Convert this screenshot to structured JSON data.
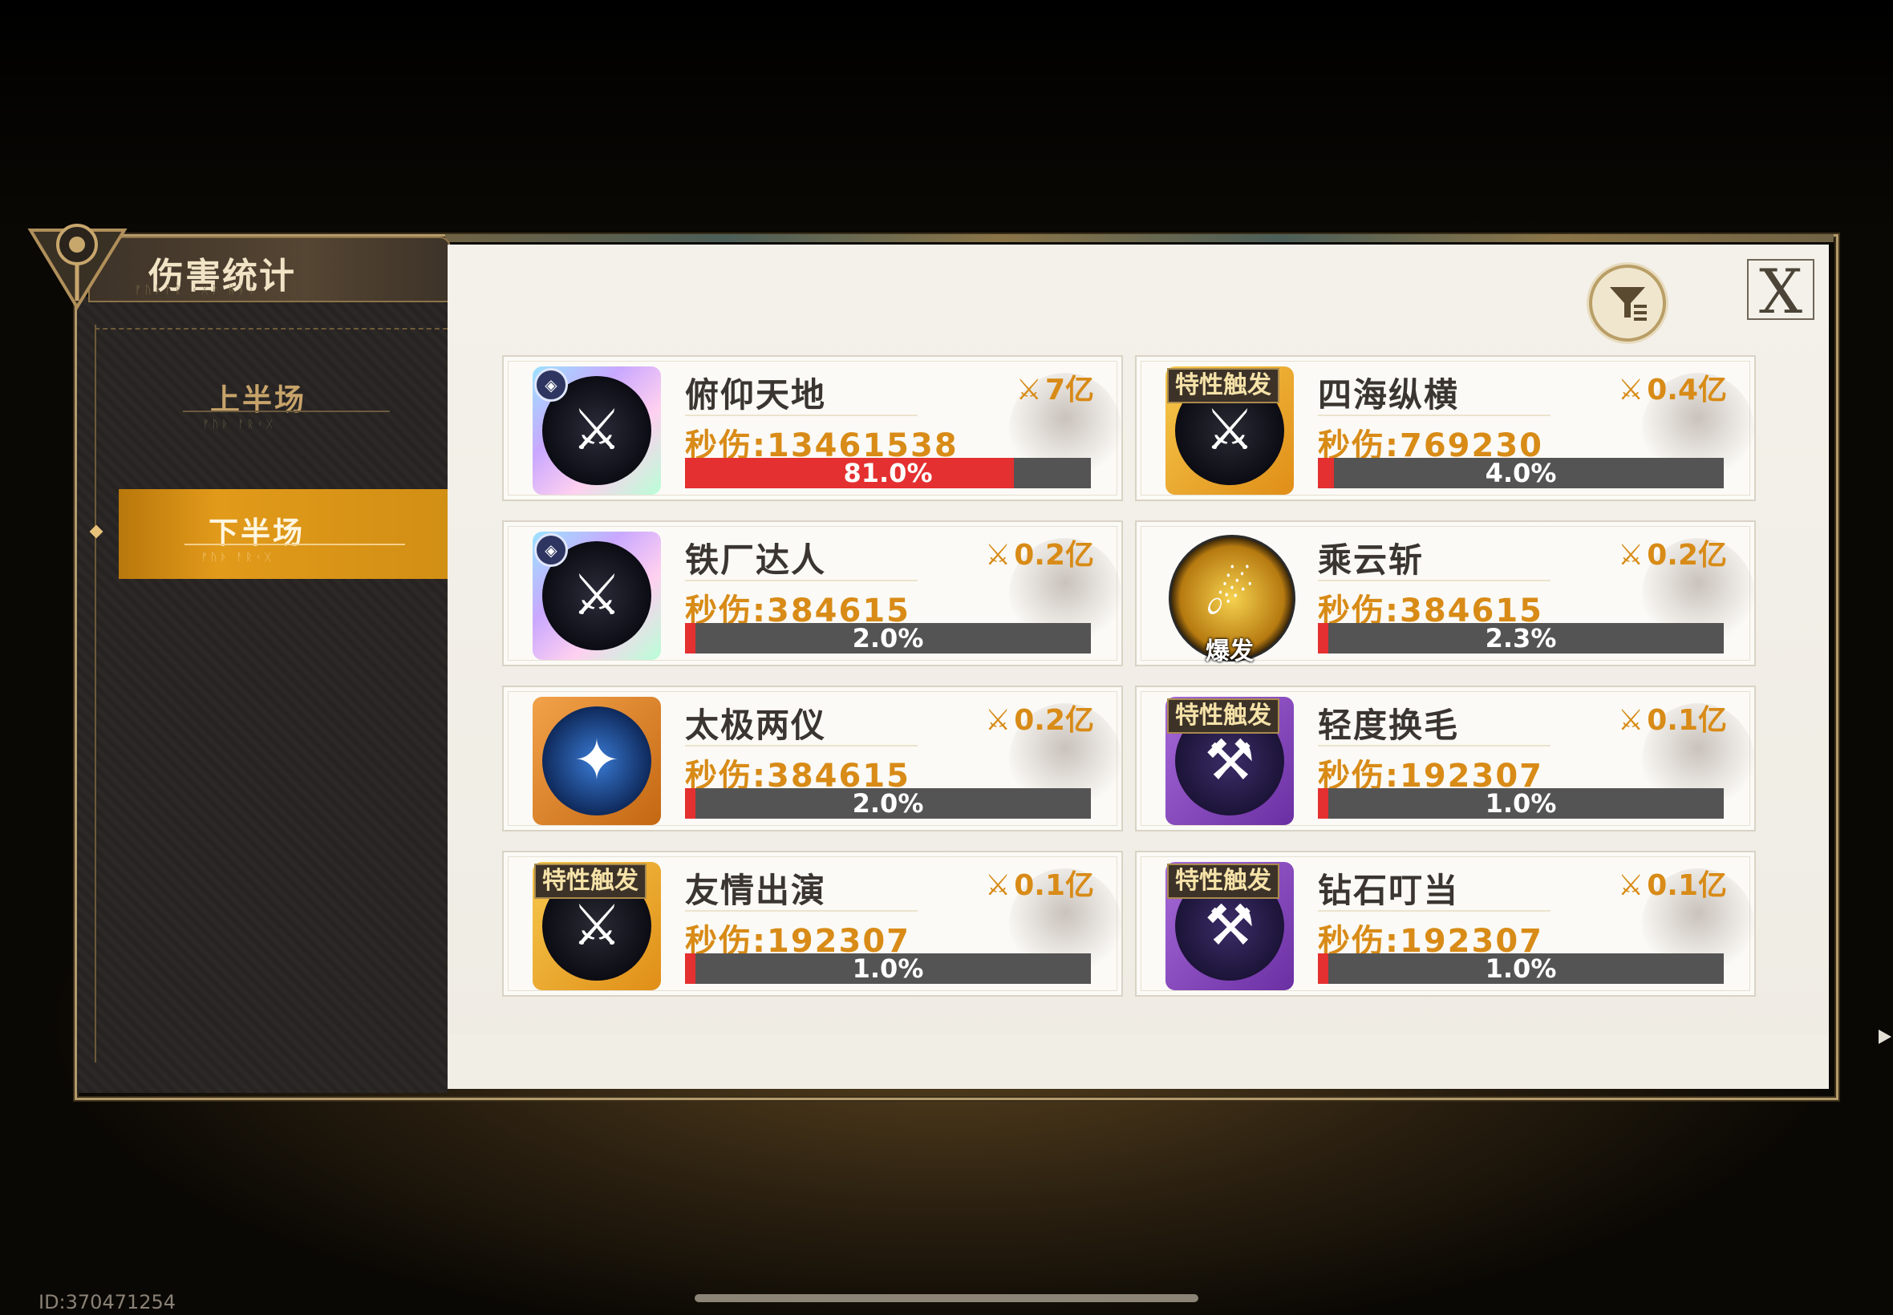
{
  "header": {
    "title": "伤害统计"
  },
  "tabs": [
    {
      "label": "上半场",
      "active": false
    },
    {
      "label": "下半场",
      "active": true
    }
  ],
  "controls": {
    "close_label": "X"
  },
  "cards": [
    {
      "name": "俯仰天地",
      "total": "7亿",
      "dps": "秒伤:13461538",
      "percent_label": "81.0%",
      "fraction": 0.81,
      "badge": "",
      "bottom_tag": "",
      "icon_style": "rainbow",
      "icon": "sword-fan-icon"
    },
    {
      "name": "四海纵横",
      "total": "0.4亿",
      "dps": "秒伤:769230",
      "percent_label": "4.0%",
      "fraction": 0.04,
      "badge": "特性触发",
      "bottom_tag": "",
      "icon_style": "gold",
      "icon": "sword-fan-icon"
    },
    {
      "name": "铁厂达人",
      "total": "0.2亿",
      "dps": "秒伤:384615",
      "percent_label": "2.0%",
      "fraction": 0.02,
      "badge": "",
      "bottom_tag": "",
      "icon_style": "rainbow",
      "icon": "pixel-blocks-icon"
    },
    {
      "name": "乘云斩",
      "total": "0.2亿",
      "dps": "秒伤:384615",
      "percent_label": "2.3%",
      "fraction": 0.023,
      "badge": "",
      "bottom_tag": "爆发",
      "icon_style": "round-gold",
      "icon": "golden-blade-icon"
    },
    {
      "name": "太极两仪",
      "total": "0.2亿",
      "dps": "秒伤:384615",
      "percent_label": "2.0%",
      "fraction": 0.02,
      "badge": "",
      "bottom_tag": "",
      "icon_style": "orange",
      "icon": "crystal-sword-icon"
    },
    {
      "name": "轻度换毛",
      "total": "0.1亿",
      "dps": "秒伤:192307",
      "percent_label": "1.0%",
      "fraction": 0.01,
      "badge": "特性触发",
      "bottom_tag": "",
      "icon_style": "purple",
      "icon": "hammer-icon"
    },
    {
      "name": "友情出演",
      "total": "0.1亿",
      "dps": "秒伤:192307",
      "percent_label": "1.0%",
      "fraction": 0.01,
      "badge": "特性触发",
      "bottom_tag": "",
      "icon_style": "gold",
      "icon": "chibi-hero-icon"
    },
    {
      "name": "钻石叮当",
      "total": "0.1亿",
      "dps": "秒伤:192307",
      "percent_label": "1.0%",
      "fraction": 0.01,
      "badge": "特性触发",
      "bottom_tag": "",
      "icon_style": "purple",
      "icon": "golden-bell-icon"
    }
  ],
  "footer": {
    "id": "ID:370471254"
  },
  "colors": {
    "accent_orange": "#d88b17",
    "bar_fill": "#e43030",
    "bar_track": "#545454",
    "active_tab": "#e29a1a"
  }
}
